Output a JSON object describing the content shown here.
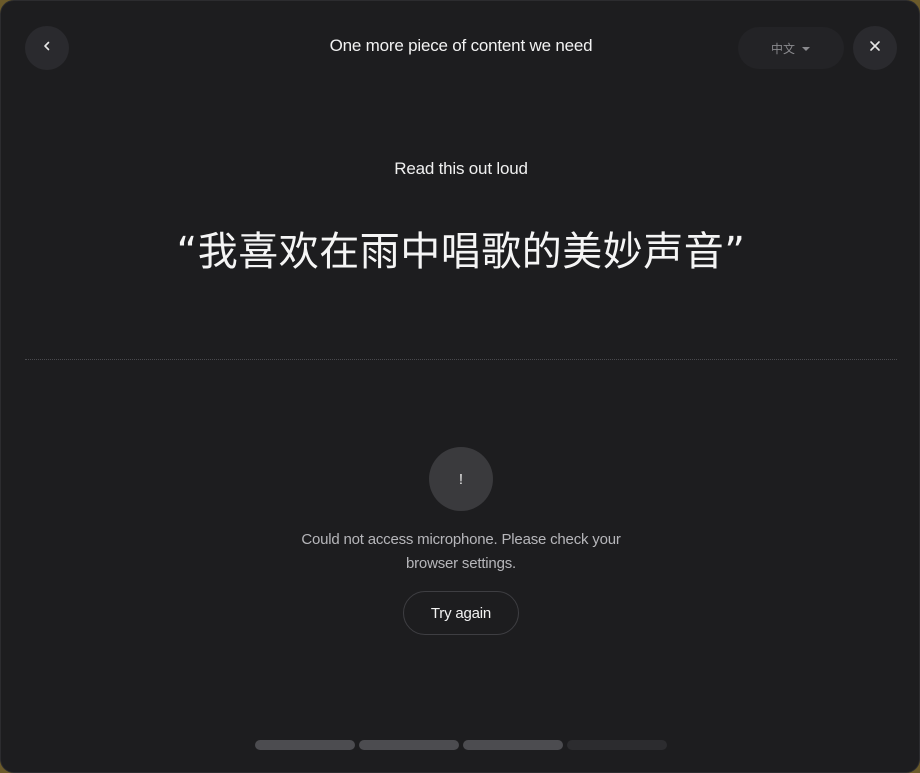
{
  "header": {
    "title": "One more piece of content we need",
    "back_icon": "chevron-left-icon",
    "close_icon": "close-icon",
    "language": {
      "selected": "中文",
      "icon": "caret-down-icon"
    }
  },
  "prompt": {
    "instruction": "Read this out loud",
    "phrase": "“我喜欢在雨中唱歌的美妙声音”"
  },
  "error": {
    "icon_symbol": "!",
    "message": "Could not access microphone. Please check your browser settings.",
    "retry_label": "Try again"
  },
  "progress": {
    "total_steps": 4,
    "completed_steps": 3
  },
  "colors": {
    "background": "#1d1d1f",
    "button": "#2a2a2e",
    "text": "#f2f2f2",
    "muted_text": "#b6b6ba",
    "progress_done": "#4c4c50",
    "progress_pending": "#2c2c2f"
  }
}
